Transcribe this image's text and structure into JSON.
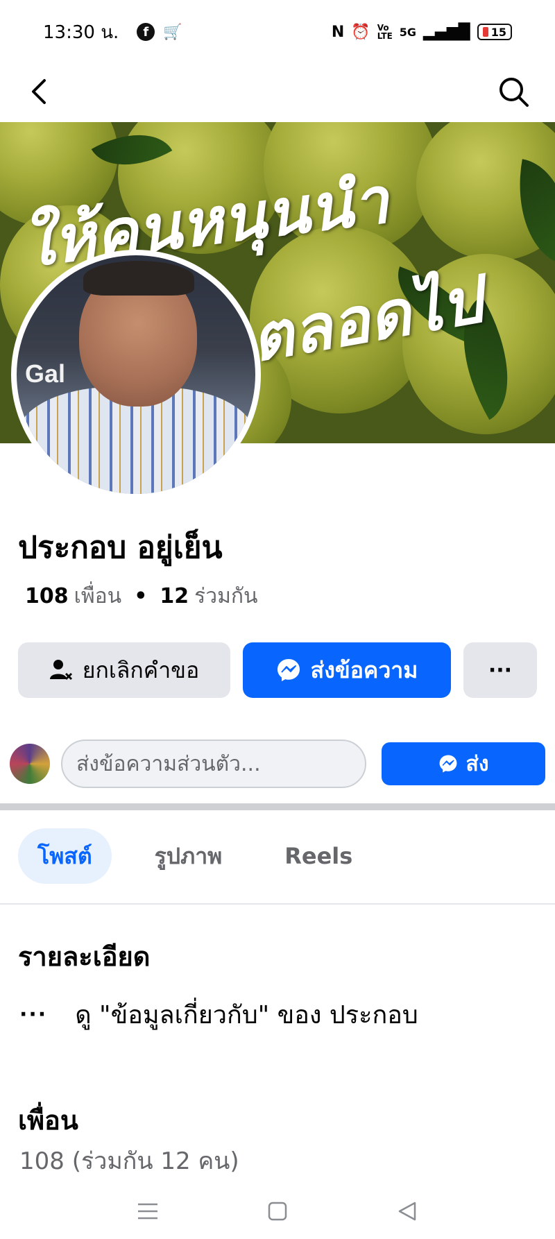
{
  "status_bar": {
    "time": "13:30 น.",
    "network": "5G",
    "battery": "15"
  },
  "profile": {
    "name": "ประกอบ อยู่เย็น",
    "friends_count": "108",
    "friends_label": "เพื่อน",
    "mutual_count": "12",
    "mutual_label": "ร่วมกัน",
    "cover_text_line1": "ให้คนหนุนนำ",
    "cover_text_line2": "ตลอดไป"
  },
  "actions": {
    "cancel_request_label": "ยกเลิกคำขอ",
    "message_label": "ส่งข้อความ",
    "more_label": "···"
  },
  "message_bar": {
    "placeholder": "ส่งข้อความส่วนตัว...",
    "send_label": "ส่ง"
  },
  "tabs": [
    {
      "label": "โพสต์",
      "active": true
    },
    {
      "label": "รูปภาพ",
      "active": false
    },
    {
      "label": "Reels",
      "active": false
    }
  ],
  "details": {
    "title": "รายละเอียด",
    "dots": "···",
    "about_text": "ดู \"ข้อมูลเกี่ยวกับ\" ของ ประกอบ"
  },
  "friends_section": {
    "title": "เพื่อน",
    "summary": "108 (ร่วมกัน 12 คน)"
  },
  "colors": {
    "accent": "#0866ff",
    "button_grey": "#e4e6eb",
    "secondary_text": "#65676b"
  }
}
